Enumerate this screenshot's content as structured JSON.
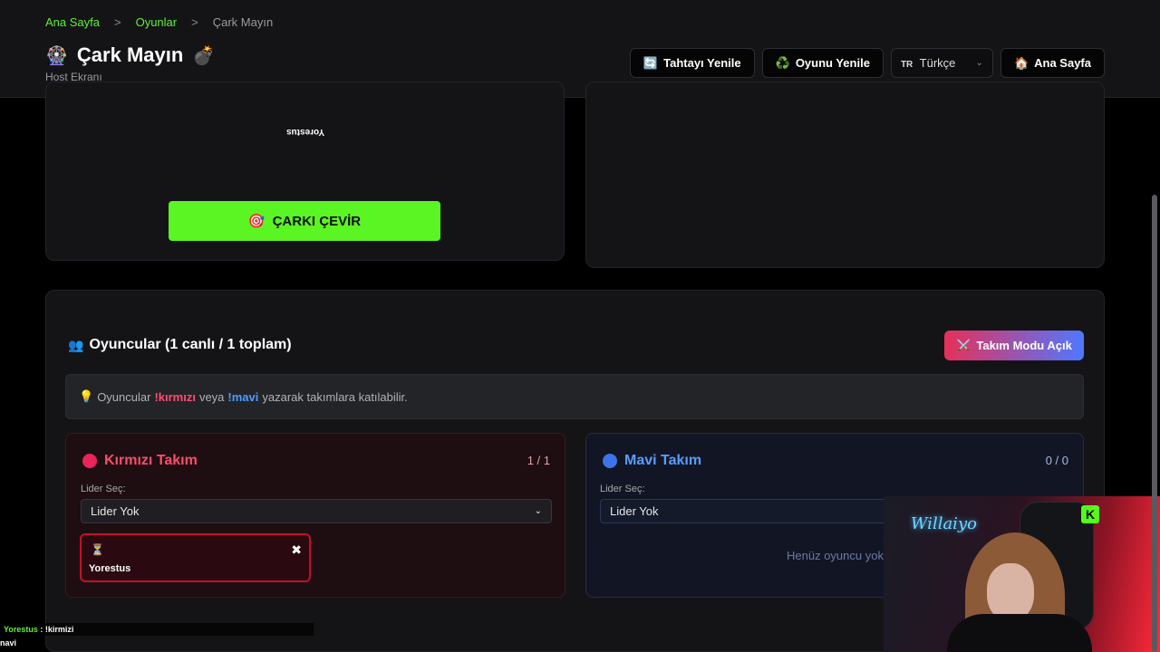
{
  "breadcrumb": {
    "home": "Ana Sayfa",
    "games": "Oyunlar",
    "current": "Çark Mayın"
  },
  "header": {
    "title": "Çark Mayın",
    "subtitle": "Host Ekranı",
    "buttons": {
      "refresh_board": "Tahtayı Yenile",
      "refresh_game": "Oyunu Yenile",
      "home": "Ana Sayfa"
    },
    "language": {
      "flag": "TR",
      "selected": "Türkçe"
    }
  },
  "wheel": {
    "flipped_player": "Yorestus",
    "spin_button": "ÇARKI ÇEVİR"
  },
  "players": {
    "title": "Oyuncular (1 canlı / 1 toplam)",
    "team_mode_button": "Takım Modu Açık",
    "info": {
      "prefix": "Oyuncular",
      "red_cmd": "!kırmızı",
      "middle": "veya",
      "blue_cmd": "!mavi",
      "suffix": "yazarak takımlara katılabilir."
    },
    "red_team": {
      "name": "Kırmızı Takım",
      "count": "1 / 1",
      "leader_label": "Lider Seç:",
      "leader_value": "Lider Yok",
      "members": [
        {
          "name": "Yorestus"
        }
      ]
    },
    "blue_team": {
      "name": "Mavi Takım",
      "count": "0 / 0",
      "leader_label": "Lider Seç:",
      "leader_value": "Lider Yok",
      "empty": "Henüz oyuncu yok"
    }
  },
  "webcam": {
    "neon_text": "Willaiyo"
  },
  "chat": {
    "line1_user": "Yorestus",
    "line1_sep": ":",
    "line1_msg": "!kirmizi",
    "line2": "navi"
  },
  "colors": {
    "accent_green": "#5bf524",
    "red": "#ff4d6d",
    "blue": "#4f9bff"
  }
}
